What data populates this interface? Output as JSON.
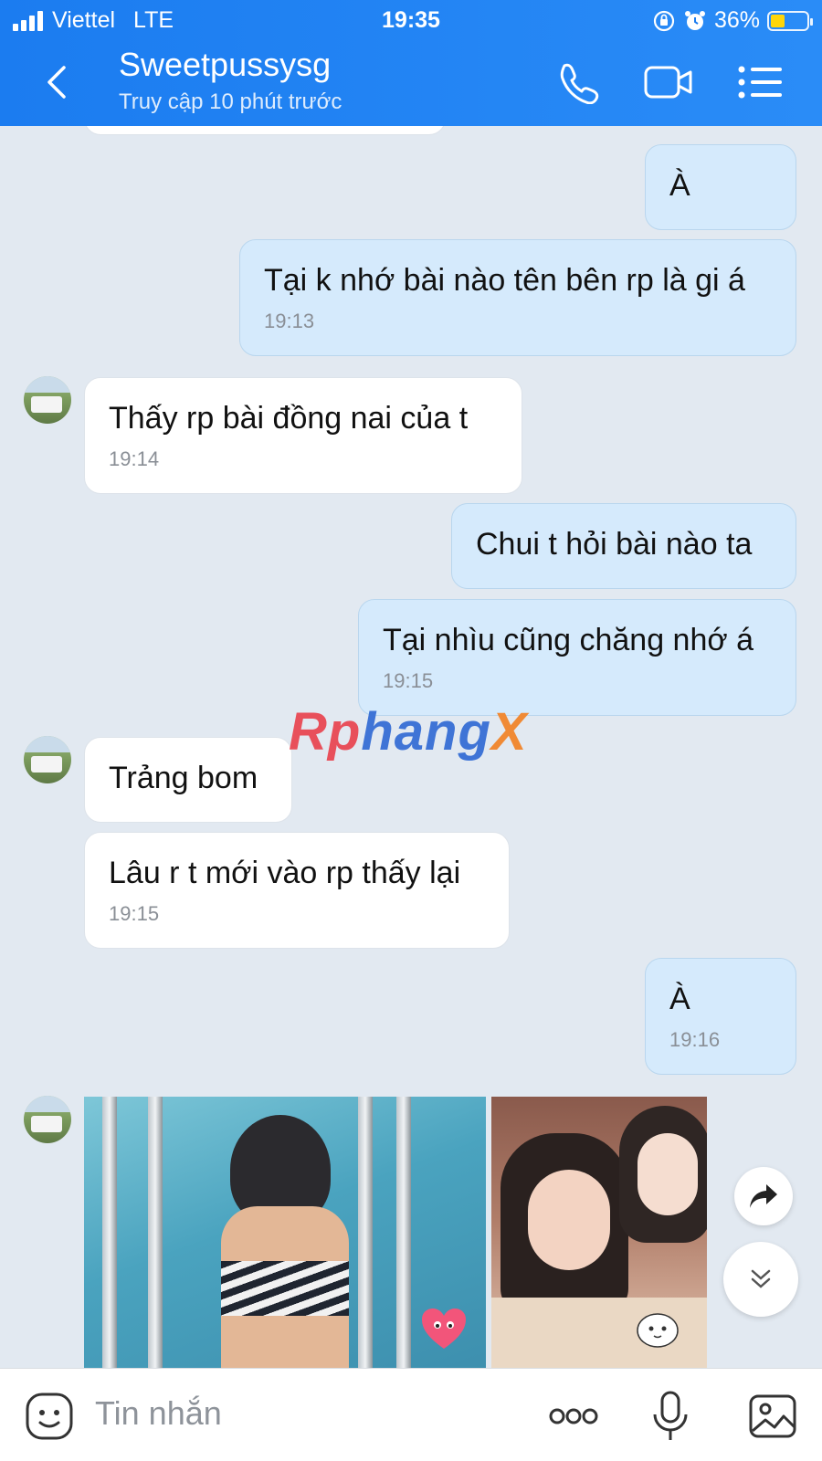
{
  "status_bar": {
    "carrier": "Viettel",
    "network": "LTE",
    "time": "19:35",
    "battery": "36%"
  },
  "header": {
    "title": "Sweetpussysg",
    "subtitle": "Truy cập 10 phút trước"
  },
  "messages": [
    {
      "dir": "out",
      "text": "À",
      "time": ""
    },
    {
      "dir": "out",
      "text": "Tại k nhớ bài nào tên bên rp là gi á",
      "time": "19:13"
    },
    {
      "dir": "in",
      "text": "Thấy rp bài đồng nai của t",
      "time": "19:14"
    },
    {
      "dir": "out",
      "text": "Chui t hỏi bài nào ta",
      "time": ""
    },
    {
      "dir": "out",
      "text": "Tại nhìu cũng chăng nhớ á",
      "time": "19:15"
    },
    {
      "dir": "in",
      "text": "Trảng bom",
      "time": ""
    },
    {
      "dir": "in",
      "text": "Lâu r t mới vào rp thấy lại",
      "time": "19:15"
    },
    {
      "dir": "out",
      "text": "À",
      "time": "19:16"
    }
  ],
  "watermark": {
    "part1": "Rp",
    "part2": "hang",
    "part3": "X"
  },
  "input": {
    "placeholder": "Tin nhắn"
  },
  "icons": {
    "back": "chevron-left-icon",
    "call": "phone-icon",
    "video": "video-camera-icon",
    "menu": "list-menu-icon",
    "forward": "share-forward-icon",
    "scroll_down": "double-chevron-down-icon",
    "emoji": "sticker-icon",
    "more": "more-dots-icon",
    "mic": "microphone-icon",
    "gallery": "image-gallery-icon"
  },
  "colors": {
    "header": "#1b7cf0",
    "outgoing": "#d5eafc",
    "incoming": "#ffffff",
    "background": "#e2e9f1"
  }
}
